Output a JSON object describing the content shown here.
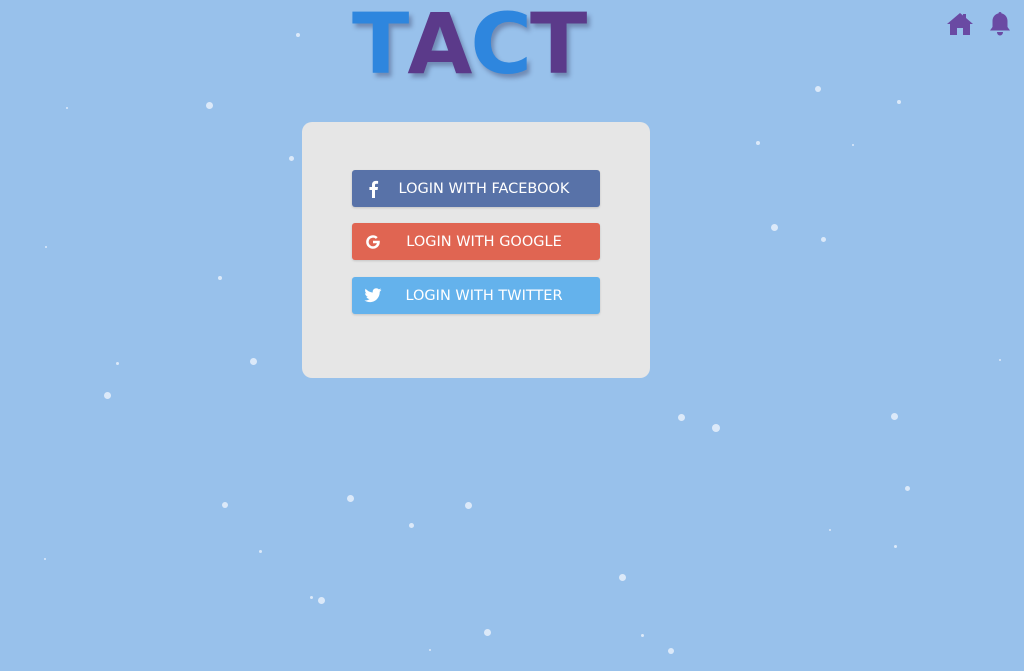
{
  "logo": {
    "letters": [
      {
        "char": "T",
        "color": "#2e86de"
      },
      {
        "char": "A",
        "color": "#5b3a8a"
      },
      {
        "char": "C",
        "color": "#2e86de"
      },
      {
        "char": "T",
        "color": "#5b3a8a"
      }
    ]
  },
  "header": {
    "icons": [
      "home-icon",
      "bell-icon"
    ],
    "icon_color": "#6a4aa3"
  },
  "login": {
    "facebook": {
      "label": "LOGIN WITH FACEBOOK",
      "color": "#5872a8",
      "icon": "facebook-icon"
    },
    "google": {
      "label": "LOGIN WITH GOOGLE",
      "color": "#e06552",
      "icon": "google-icon"
    },
    "twitter": {
      "label": "LOGIN WITH TWITTER",
      "color": "#64b2ec",
      "icon": "twitter-icon"
    }
  },
  "colors": {
    "background": "#98c1eb",
    "card": "#e6e6e6"
  }
}
